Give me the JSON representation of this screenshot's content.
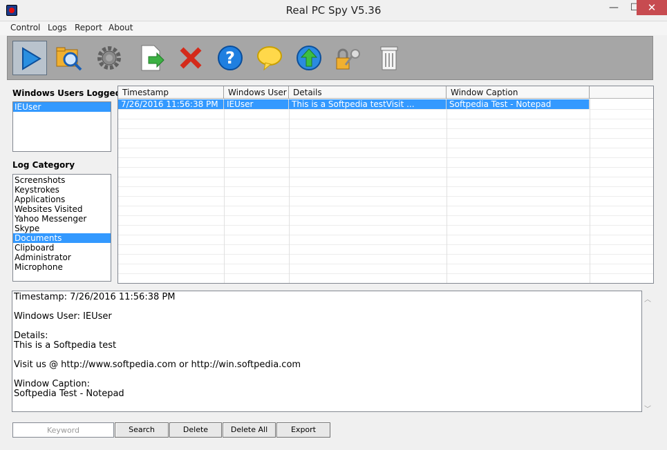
{
  "window": {
    "title": "Real PC Spy V5.36",
    "min_glyph": "—",
    "max_glyph": "☐",
    "close_glyph": "✕"
  },
  "menu": {
    "items": [
      "Control",
      "Logs",
      "Report",
      "About"
    ]
  },
  "toolbar": {
    "buttons": [
      {
        "icon": "play-icon"
      },
      {
        "icon": "search-folder-icon"
      },
      {
        "icon": "gear-icon"
      },
      {
        "icon": "export-document-icon"
      },
      {
        "icon": "delete-x-icon"
      },
      {
        "icon": "help-icon"
      },
      {
        "icon": "speech-bubble-icon"
      },
      {
        "icon": "update-globe-icon"
      },
      {
        "icon": "lock-key-icon"
      },
      {
        "icon": "trash-icon"
      }
    ]
  },
  "users": {
    "label": "Windows Users Logged",
    "items": [
      "IEUser"
    ],
    "selected": 0
  },
  "categories": {
    "label": "Log Category",
    "items": [
      "Screenshots",
      "Keystrokes",
      "Applications",
      "Websites Visited",
      "Yahoo Messenger",
      "Skype",
      "Documents",
      "Clipboard",
      "Administrator",
      "Microphone"
    ],
    "selected": 6
  },
  "grid": {
    "columns": [
      "Timestamp",
      "Windows User",
      "Details",
      "Window Caption"
    ],
    "rows": [
      [
        "7/26/2016 11:56:38 PM",
        "IEUser",
        "This is a Softpedia testVisit ...",
        "Softpedia Test - Notepad"
      ]
    ]
  },
  "detail": {
    "lines": [
      "Timestamp: 7/26/2016 11:56:38 PM",
      "",
      "Windows User: IEUser",
      "",
      "Details:",
      "This is a Softpedia test",
      "",
      "Visit us @ http://www.softpedia.com or http://win.softpedia.com",
      "",
      "Window Caption:",
      "Softpedia Test - Notepad"
    ]
  },
  "bottom": {
    "keyword_placeholder": "Keyword",
    "search_label": "Search",
    "delete_label": "Delete",
    "delete_all_label": "Delete All",
    "export_label": "Export"
  },
  "colors": {
    "selection": "#3399ff",
    "toolbar_bg": "#a6a6a6",
    "close_btn": "#c74b50"
  }
}
